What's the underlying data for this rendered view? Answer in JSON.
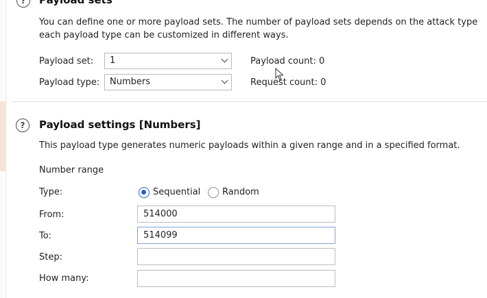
{
  "payload_sets": {
    "title": "Payload sets",
    "description_line1": "You can define one or more payload sets. The number of payload sets depends on the attack type",
    "description_line2": "each payload type can be customized in different ways.",
    "payload_set_label": "Payload set:",
    "payload_set_value": "1",
    "payload_type_label": "Payload type:",
    "payload_type_value": "Numbers",
    "payload_count": "Payload count: 0",
    "request_count": "Request count: 0"
  },
  "payload_settings": {
    "title": "Payload settings [Numbers]",
    "description": "This payload type generates numeric payloads within a given range and in a specified format.",
    "number_range_label": "Number range",
    "type_label": "Type:",
    "type_options": [
      "Sequential",
      "Random"
    ],
    "type_selected": "Sequential",
    "from_label": "From:",
    "from_value": "514000",
    "to_label": "To:",
    "to_value": "514099",
    "step_label": "Step:",
    "step_value": "",
    "how_many_label": "How many:",
    "how_many_value": ""
  },
  "icons": {
    "help": "help-icon",
    "chevron": "chevron-down-icon"
  },
  "colors": {
    "radio_selected": "#2563c4",
    "focus_border": "#7fa4d4"
  }
}
